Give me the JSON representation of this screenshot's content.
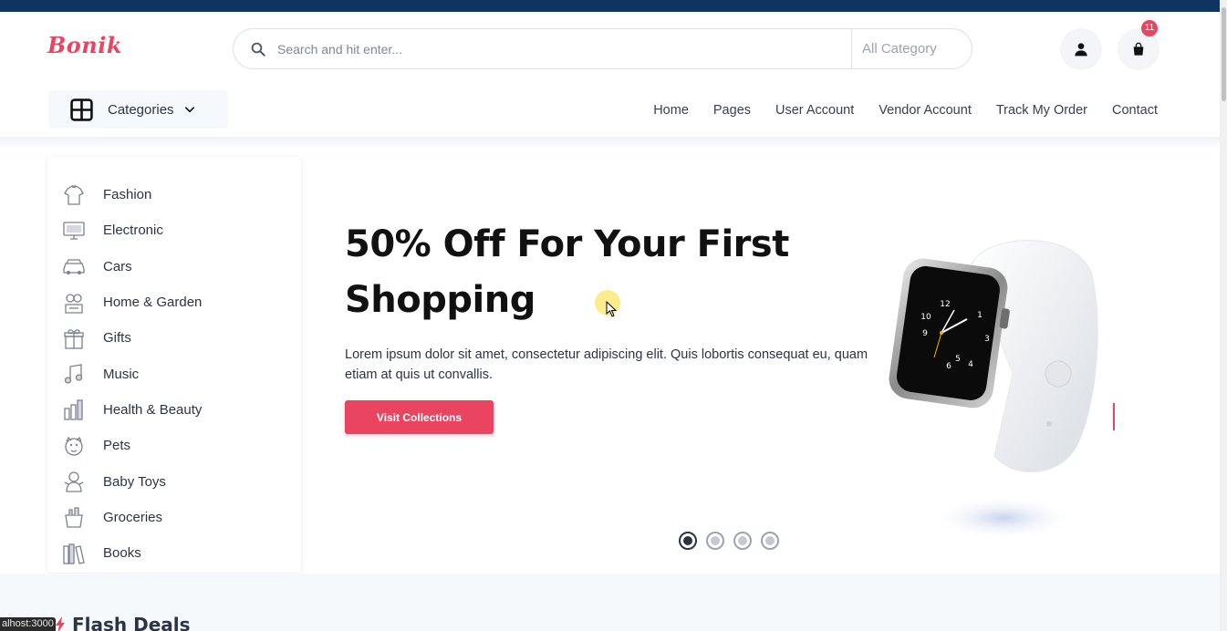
{
  "header": {
    "logo": "Bonik",
    "search_placeholder": "Search and hit enter...",
    "category_select": "All Category",
    "cart_count": "11",
    "icons": {
      "search": "search-icon",
      "user": "user-icon",
      "cart": "shopping-bag-icon"
    }
  },
  "categories_button": {
    "label": "Categories",
    "icon": "grid-icon",
    "chevron": "chevron-down-icon"
  },
  "nav": [
    "Home",
    "Pages",
    "User Account",
    "Vendor Account",
    "Track My Order",
    "Contact"
  ],
  "sidebar": {
    "items": [
      {
        "label": "Fashion",
        "icon": "fashion-icon"
      },
      {
        "label": "Electronic",
        "icon": "electronic-icon"
      },
      {
        "label": "Cars",
        "icon": "car-icon"
      },
      {
        "label": "Home & Garden",
        "icon": "home-garden-icon"
      },
      {
        "label": "Gifts",
        "icon": "gift-icon"
      },
      {
        "label": "Music",
        "icon": "music-icon"
      },
      {
        "label": "Health & Beauty",
        "icon": "health-beauty-icon"
      },
      {
        "label": "Pets",
        "icon": "pet-icon"
      },
      {
        "label": "Baby Toys",
        "icon": "baby-toys-icon"
      },
      {
        "label": "Groceries",
        "icon": "groceries-icon"
      },
      {
        "label": "Books",
        "icon": "books-icon"
      }
    ]
  },
  "hero": {
    "title_line1": "50% Off For Your First",
    "title_line2": "Shopping",
    "description": "Lorem ipsum dolor sit amet, consectetur adipiscing elit. Quis lobortis consequat eu, quam etiam at quis ut convallis.",
    "button": "Visit Collections",
    "carousel": {
      "count": 4,
      "active": 1
    }
  },
  "flash_deals": {
    "title": "Flash Deals"
  },
  "status_bar": "alhost:3000",
  "colors": {
    "primary": "#e94560",
    "topbar": "#0f3460",
    "text": "#2b3445"
  }
}
